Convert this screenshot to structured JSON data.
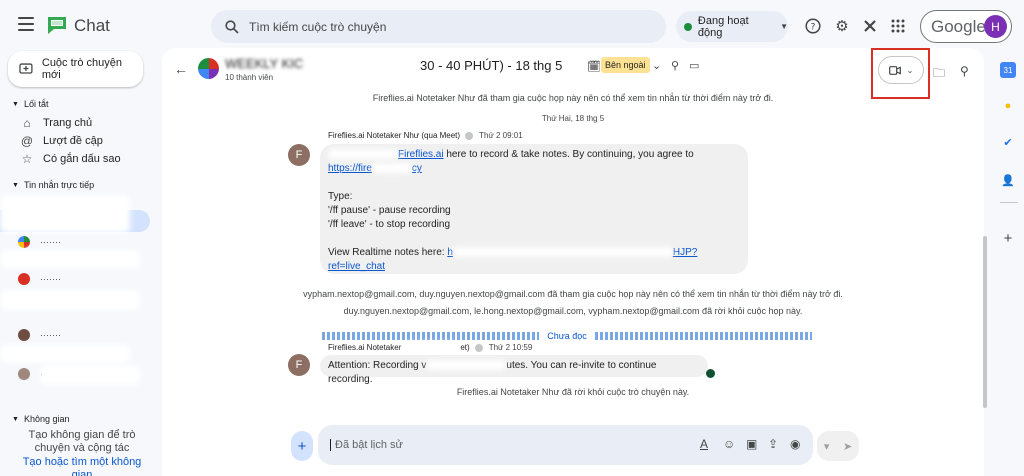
{
  "app": {
    "title": "Chat"
  },
  "search": {
    "placeholder": "Tìm kiếm cuộc trò chuyện"
  },
  "status": {
    "label": "Đang hoạt động",
    "color": "#1e8e3e"
  },
  "account": {
    "brand": "Google",
    "initial": "H"
  },
  "sidebar": {
    "new_chat": "Cuộc trò chuyện mới",
    "shortcuts_header": "Lối tắt",
    "shortcuts": [
      {
        "label": "Trang chủ",
        "icon": "home-icon"
      },
      {
        "label": "Lượt đề cập",
        "icon": "at-icon"
      },
      {
        "label": "Có gắn dấu sao",
        "icon": "star-icon"
      }
    ],
    "dm_header": "Tin nhắn trực tiếp",
    "spaces_header": "Không gian",
    "spaces_empty": "Tạo không gian để trò chuyện và cộng tác",
    "spaces_link": "Tạo hoặc tìm một không gian"
  },
  "conversation": {
    "title_start": "WEEKLY KIC",
    "title_rest": "30 - 40 PHÚT) - 18 thg 5",
    "members": "10 thành viên",
    "external_badge": "Bên ngoài"
  },
  "messages": {
    "sys_top": "Fireflies.ai Notetaker Như đã tham gia cuộc họp này nên có thể xem tin nhắn từ thời điểm này trở đi.",
    "date_divider": "Thứ Hai, 18 thg 5",
    "m1": {
      "initial": "F",
      "sender": "Fireflies.ai Notetaker Như (qua Meet)",
      "time": "Thứ 2 09:01",
      "line1_link": "Fireflies.ai",
      "line1_rest": " here to record & take notes.  By continuing, you agree to",
      "line2_link": "https://fire",
      "line2_tail": "cy",
      "type_label": "Type:",
      "cmd1": "'/ff pause' - pause recording",
      "cmd2": "'/ff leave' - to stop recording",
      "view_label": "View Realtime notes here: ",
      "view_link_a": "h",
      "view_link_b": "HJP?",
      "view_link_c": "ref=live_chat"
    },
    "sys_join1": "vypham.nextop@gmail.com, duy.nguyen.nextop@gmail.com đã tham gia cuộc họp này nên có thể xem tin nhắn từ thời điểm này trở đi.",
    "sys_left1": "duy.nguyen.nextop@gmail.com, le.hong.nextop@gmail.com, vypham.nextop@gmail.com đã rời khỏi cuộc họp này.",
    "unread_label": "Chưa đọc",
    "m2": {
      "initial": "F",
      "sender": "Fireflies.ai Notetaker",
      "sender_tail": "et)",
      "time": "Thứ 2 10:59",
      "text_a": "Attention: Recording v",
      "text_b": "utes. You can re-invite to continue recording."
    },
    "sys_bottom": "Fireflies.ai Notetaker Như đã rời khỏi cuộc trò chuyện này."
  },
  "composer": {
    "placeholder": "Đã bật lịch sử"
  },
  "colors": {
    "accent": "#0b57d0",
    "selected_bg": "#d3e3fd",
    "highlight_box": "#d93025"
  }
}
